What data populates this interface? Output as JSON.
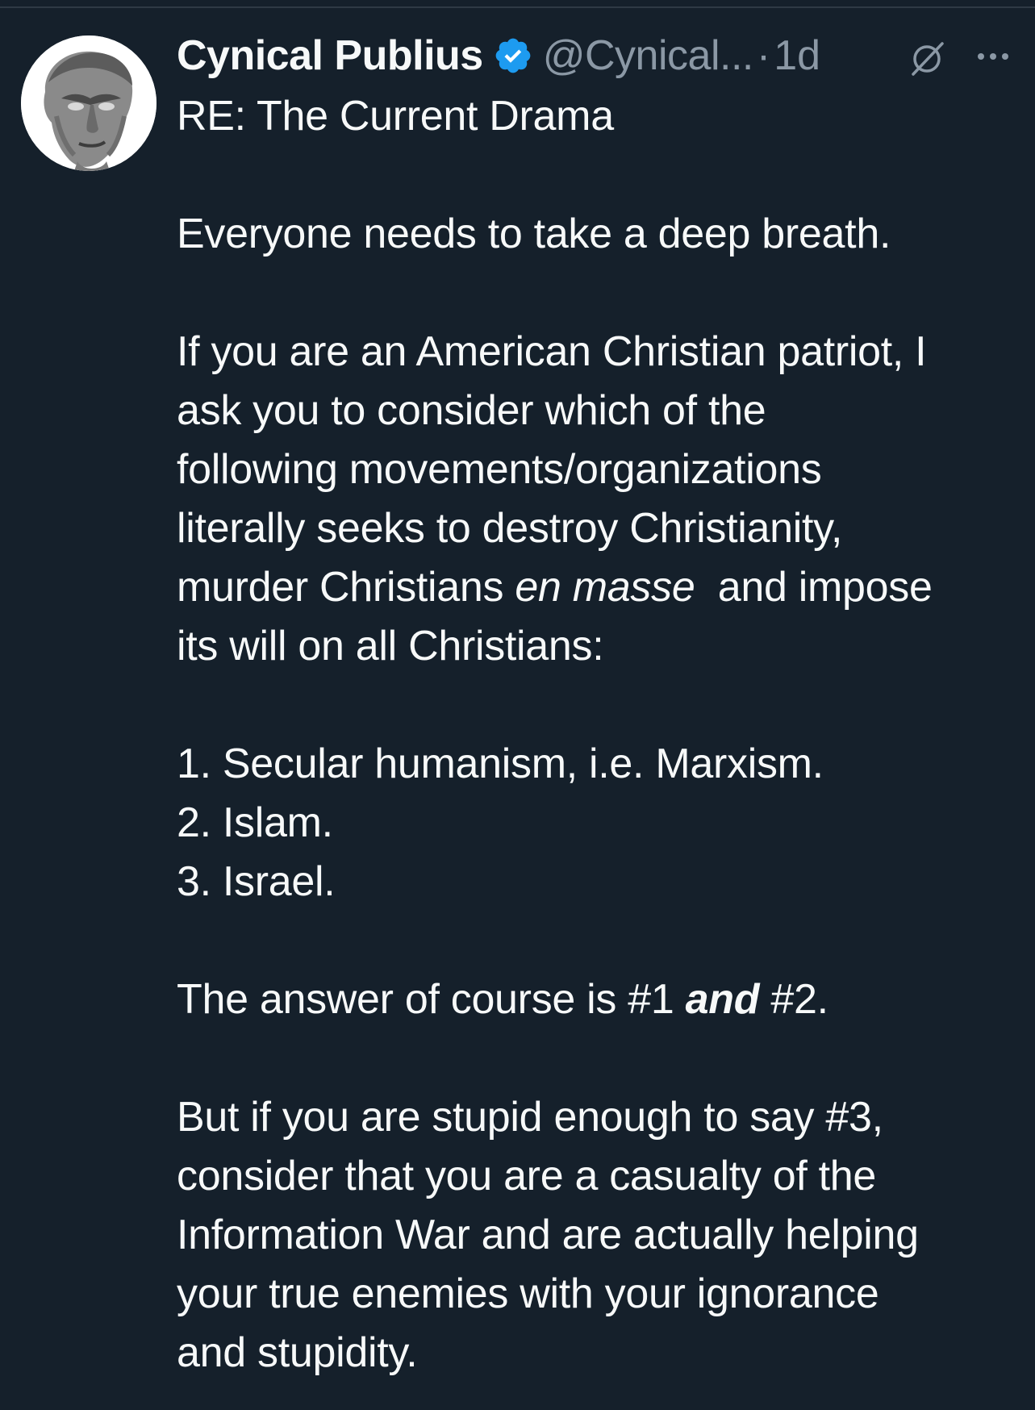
{
  "tweet": {
    "display_name": "Cynical Publius",
    "handle": "@Cynical...",
    "separator": "·",
    "time": "1d",
    "verified_icon": "verified-badge-icon",
    "grok_icon": "grok-icon",
    "more_icon": "more-options-icon",
    "avatar": "bust-of-roman-statue-avatar",
    "lines": {
      "l1": "RE: The Current Drama",
      "l2": "Everyone needs to take a deep breath.",
      "l3": "If you are an American Christian patriot, I",
      "l4": "ask you to consider which of the",
      "l5": "following movements/organizations",
      "l6": "literally seeks to destroy Christianity,",
      "l7_a": "murder Christians ",
      "l7_b": "en masse",
      "l7_c": "  and impose",
      "l8": "its will on all Christians:",
      "l9": "1. Secular humanism, i.e. Marxism.",
      "l10": "2. Islam.",
      "l11": "3. Israel.",
      "l12_a": "The answer of course is #1 ",
      "l12_b": "and",
      "l12_c": " #2.",
      "l13": "But if you are stupid enough to say #3,",
      "l14": "consider that you are a casualty of the",
      "l15": "Information War and are actually helping",
      "l16": "your true enemies with your ignorance",
      "l17": "and stupidity."
    }
  },
  "colors": {
    "background": "#15202b",
    "text": "#f7f9f9",
    "secondary": "#8b98a5",
    "verified": "#1d9bf0"
  }
}
